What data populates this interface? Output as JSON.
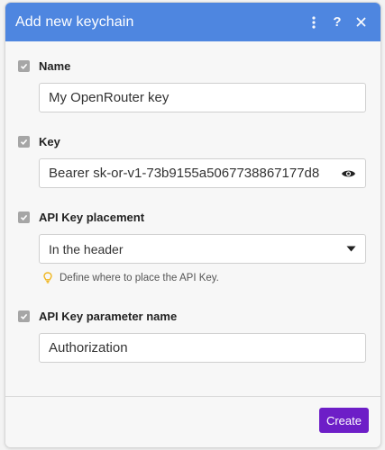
{
  "dialog": {
    "title": "Add new keychain"
  },
  "fields": {
    "name": {
      "label": "Name",
      "value": "My OpenRouter key"
    },
    "key": {
      "label": "Key",
      "value": "Bearer sk-or-v1-73b9155a5067738867177d8"
    },
    "placement": {
      "label": "API Key placement",
      "value": "In the header",
      "hint": "Define where to place the API Key."
    },
    "param": {
      "label": "API Key parameter name",
      "value": "Authorization"
    }
  },
  "footer": {
    "create_label": "Create"
  },
  "icons": {
    "menu": "vertical-dots-icon",
    "help": "question-mark-icon",
    "close": "close-icon",
    "reveal": "eye-icon",
    "dropdown": "caret-down-icon",
    "hint": "lightbulb-icon",
    "checkbox": "checkbox-icon"
  },
  "colors": {
    "header": "#4e86e0",
    "primary_button": "#6d1ec7",
    "checkbox": "#a6a6a6"
  }
}
